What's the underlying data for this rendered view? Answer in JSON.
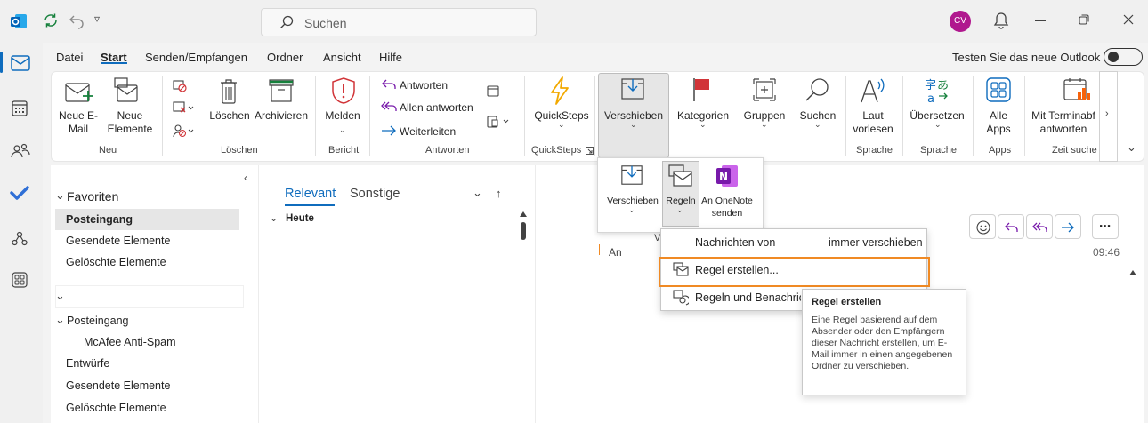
{
  "colors": {
    "accent": "#0f6cbd",
    "highlight_border": "#f08a24",
    "avatar_bg": "#b0178e",
    "flag_red": "#d13438",
    "onenote_purple": "#7719aa",
    "quickstep_yellow": "#f2a900"
  },
  "titlebar": {
    "search_placeholder": "Suchen",
    "avatar_initials": "CV"
  },
  "menu_tabs": [
    "Datei",
    "Start",
    "Senden/Empfangen",
    "Ordner",
    "Ansicht",
    "Hilfe"
  ],
  "new_outlook_label": "Testen Sie das neue Outlook",
  "ribbon": {
    "neue_email": "Neue E-Mail",
    "neue_elemente": "Neue Elemente",
    "group_neu": "Neu",
    "loeschen": "Löschen",
    "archivieren": "Archivieren",
    "group_loeschen": "Löschen",
    "melden": "Melden",
    "group_bericht": "Bericht",
    "antworten": "Antworten",
    "allen_antworten": "Allen antworten",
    "weiterleiten": "Weiterleiten",
    "group_antworten": "Antworten",
    "quicksteps": "QuickSteps",
    "group_quicksteps": "QuickSteps",
    "verschieben": "Verschieben",
    "kategorien": "Kategorien",
    "gruppen": "Gruppen",
    "suchen": "Suchen",
    "laut_vorlesen": "Laut vorlesen",
    "group_sprache1": "Sprache",
    "uebersetzen": "Übersetzen",
    "group_sprache2": "Sprache",
    "alle_apps": "Alle Apps",
    "group_apps": "Apps",
    "terminabfrage": "Mit Terminabf antworten",
    "group_zeitsuche": "Zeit suchen"
  },
  "dropdown": {
    "verschieben": "Verschieben",
    "regeln": "Regeln",
    "onenote": "An OneNote senden"
  },
  "folders": {
    "favoriten": "Favoriten",
    "posteingang_fav": "Posteingang",
    "gesendete_fav": "Gesendete Elemente",
    "geloeschte_fav": "Gelöschte Elemente",
    "posteingang": "Posteingang",
    "mcafee": "McAfee Anti-Spam",
    "entwuerfe": "Entwürfe",
    "gesendete": "Gesendete Elemente",
    "geloeschte": "Gelöschte Elemente"
  },
  "message_list": {
    "tab_relevant": "Relevant",
    "tab_sonstige": "Sonstige",
    "group_heute": "Heute"
  },
  "reading": {
    "an_label": "An",
    "time": "09:46"
  },
  "rules_menu": {
    "item1_left": "Nachrichten von",
    "item1_right": "immer verschieben",
    "item2": "Regel erstellen...",
    "item3": "Regeln und Benachrich"
  },
  "tooltip": {
    "title": "Regel erstellen",
    "body": "Eine Regel basierend auf dem Absender oder den Empfängern dieser Nachricht erstellen, um E-Mail immer in einen angegebenen Ordner zu verschieben."
  }
}
